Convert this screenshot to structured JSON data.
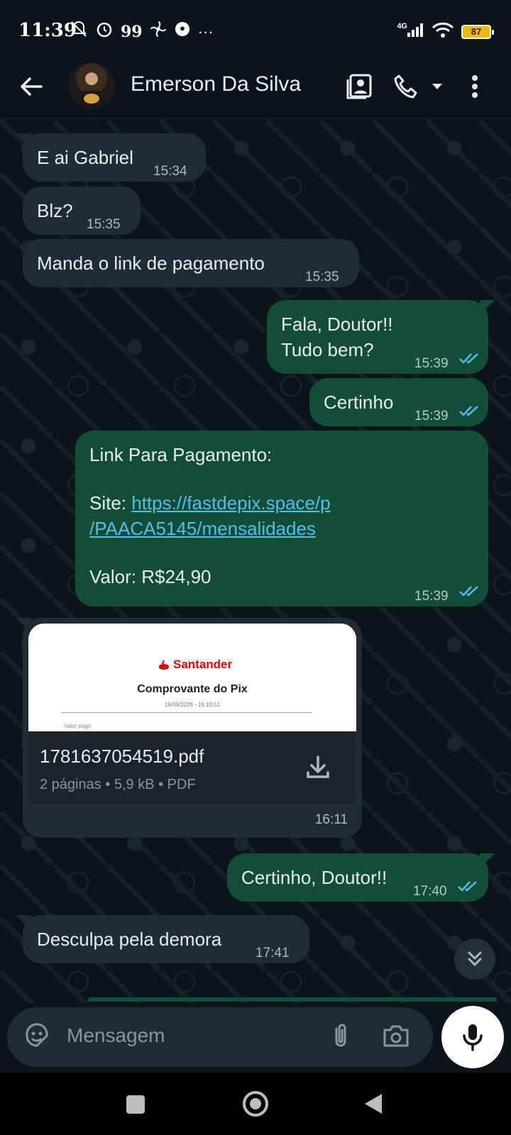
{
  "status_bar": {
    "time": "11:39",
    "extra": "99",
    "dots": "···",
    "network": "4G",
    "battery": "87"
  },
  "header": {
    "contact_name": "Emerson Da Silva"
  },
  "messages": [
    {
      "direction": "in",
      "text": "E ai Gabriel",
      "time": "15:34"
    },
    {
      "direction": "in",
      "text": "Blz?",
      "time": "15:35"
    },
    {
      "direction": "in",
      "text": "Manda o link de pagamento",
      "time": "15:35"
    },
    {
      "direction": "out",
      "text_line1": "Fala, Doutor!!",
      "text_line2": "Tudo bem?",
      "time": "15:39",
      "read": true
    },
    {
      "direction": "out",
      "text": "Certinho",
      "time": "15:39",
      "read": true
    },
    {
      "direction": "out",
      "title": "Link Para Pagamento:",
      "site_label": "Site: ",
      "link_line1": "https://fastdepix.space/p",
      "link_line2": "/PAACA5145/mensalidades",
      "value": "Valor: R$24,90",
      "time": "15:39",
      "read": true
    },
    {
      "direction": "in",
      "type": "document",
      "preview_brand": "Santander",
      "preview_title": "Comprovante do Pix",
      "preview_date": "16/06/2026 - 16:10:51",
      "preview_field": "Valor pago",
      "filename": "1781637054519.pdf",
      "meta": "2 páginas • 5,9 kB • PDF",
      "time": "16:11"
    },
    {
      "direction": "out",
      "text": "Certinho, Doutor!!",
      "time": "17:40",
      "read": true
    },
    {
      "direction": "in",
      "text": "Desculpa pela demora",
      "time": "17:41"
    }
  ],
  "input": {
    "placeholder": "Mensagem"
  },
  "colors": {
    "background": "#0b141a",
    "incoming": "#202c33",
    "outgoing": "#144d37",
    "read_ticks": "#53bdeb",
    "link": "#53bdeb",
    "santander_red": "#ec0000"
  },
  "icons": [
    "back-arrow-icon",
    "contact-card-icon",
    "phone-icon",
    "dropdown-icon",
    "more-vertical-icon",
    "double-check-icon",
    "download-icon",
    "chevron-double-down-icon",
    "sticker-icon",
    "paperclip-icon",
    "camera-icon",
    "microphone-icon"
  ]
}
